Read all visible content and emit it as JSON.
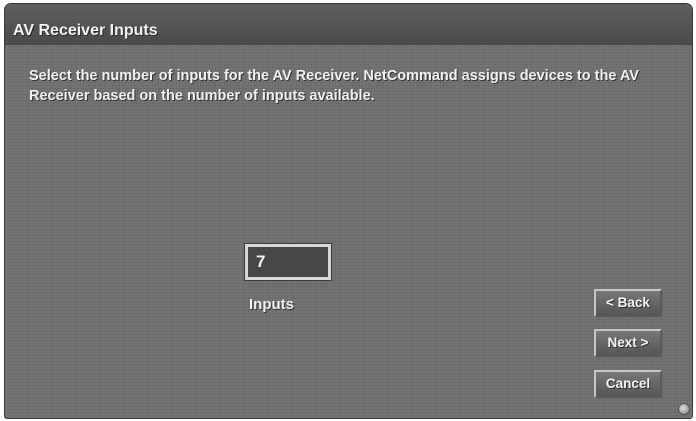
{
  "window": {
    "title": "AV Receiver Inputs"
  },
  "instructions": "Select the number of inputs for the AV Receiver. NetCommand assigns devices to the AV Receiver based on the number of inputs available.",
  "inputs": {
    "value": "7",
    "label": "Inputs"
  },
  "buttons": {
    "back": "< Back",
    "next": "Next >",
    "cancel": "Cancel"
  },
  "icons": {
    "corner": "circle-icon"
  }
}
